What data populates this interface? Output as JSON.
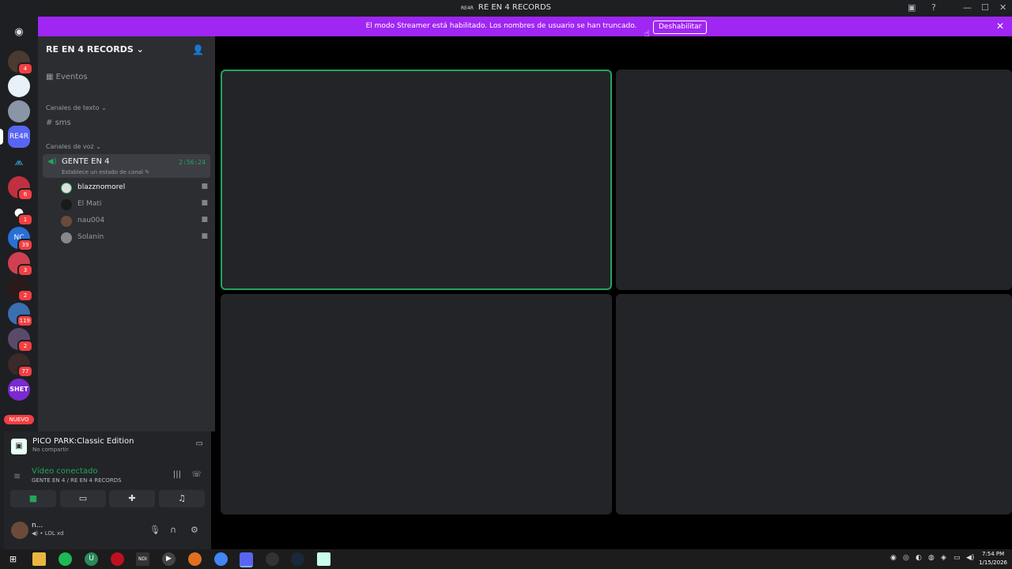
{
  "window": {
    "title": "RE EN 4 RECORDS",
    "title_prefix": "RE4R"
  },
  "banner": {
    "message": "El modo Streamer está habilitado. Los nombres de usuario se han truncado.",
    "disable_label": "Deshabilitar"
  },
  "guilds": {
    "items": [
      {
        "label": "",
        "badge": "4"
      },
      {
        "label": "",
        "badge": ""
      },
      {
        "label": "",
        "badge": ""
      },
      {
        "label": "RE4R",
        "badge": ""
      },
      {
        "label": "",
        "badge": ""
      },
      {
        "label": "",
        "badge": "6"
      },
      {
        "label": "",
        "badge": "1"
      },
      {
        "label": "NC",
        "badge": "39"
      },
      {
        "label": "",
        "badge": "3"
      },
      {
        "label": "",
        "badge": "2"
      },
      {
        "label": "",
        "badge": "119"
      },
      {
        "label": "",
        "badge": "2"
      },
      {
        "label": "",
        "badge": "77"
      },
      {
        "label": "SHET",
        "badge": ""
      }
    ],
    "new_label": "NUEVO"
  },
  "sidebar": {
    "server_name": "RE EN 4 RECORDS",
    "events_label": "Eventos",
    "text_category": "Canales de texto",
    "text_channel": "sms",
    "voice_category": "Canales de voz",
    "voice_channel": {
      "name": "GENTE EN 4",
      "status": "Establece un estado de canal",
      "time": "2:56:24"
    },
    "members": [
      {
        "name": "blazznomorel",
        "speaking": true
      },
      {
        "name": "El Mati",
        "speaking": false
      },
      {
        "name": "nau004",
        "speaking": false
      },
      {
        "name": "Solanin",
        "speaking": false
      }
    ]
  },
  "panel": {
    "game_title": "PICO PARK:Classic Edition",
    "game_sub": "No compartir",
    "vc_title": "Vídeo conectado",
    "vc_sub": "GENTE EN 4 / RE EN 4 RECORDS",
    "user_name": "n...",
    "user_status": "LOL xd"
  },
  "taskbar": {
    "time": "7:54 PM",
    "date": "1/15/2026"
  }
}
